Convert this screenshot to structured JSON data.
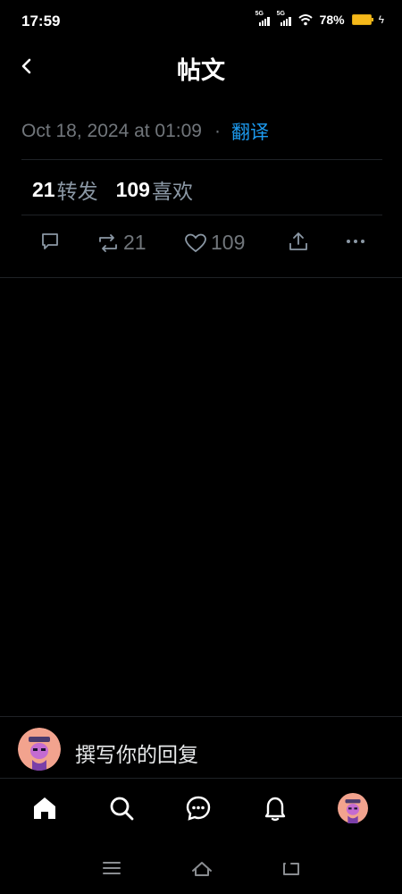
{
  "status_bar": {
    "time": "17:59",
    "network_1": "5G",
    "network_2": "5G",
    "battery_percent": "78%",
    "battery_color": "#f5b81a"
  },
  "header": {
    "back_icon": "chevron-left-icon",
    "title": "帖文"
  },
  "post": {
    "timestamp": "Oct 18, 2024 at 01:09",
    "separator": "·",
    "translate_label": "翻译",
    "accent_color": "#1d9bf0",
    "stats": {
      "reposts_count": "21",
      "reposts_label": "转发",
      "likes_count": "109",
      "likes_label": "喜欢"
    },
    "actions": {
      "reply_icon": "comment-icon",
      "repost_icon": "repost-icon",
      "repost_count": "21",
      "like_icon": "heart-icon",
      "like_count": "109",
      "share_icon": "share-icon",
      "more_icon": "more-icon"
    }
  },
  "reply_bar": {
    "placeholder": "撰写你的回复",
    "avatar_icon": "avatar"
  },
  "bottom_nav": {
    "items": [
      "home-icon",
      "search-icon",
      "messages-icon",
      "notifications-icon",
      "profile-avatar"
    ]
  },
  "system_nav": {
    "items": [
      "menu-icon",
      "home-icon",
      "back-icon"
    ]
  }
}
